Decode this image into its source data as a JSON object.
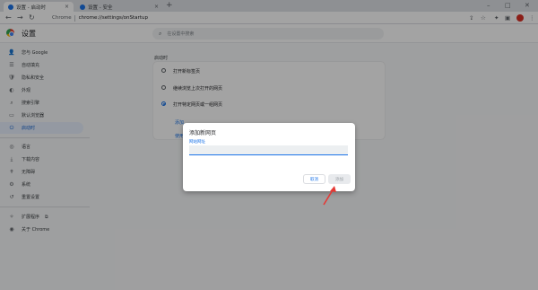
{
  "browser": {
    "tabs": [
      {
        "label": "设置 - 启动时",
        "active": true,
        "close": "×"
      },
      {
        "label": "设置 - 安全",
        "active": false,
        "close": "×"
      }
    ],
    "new_tab": "+",
    "window_controls": {
      "minimize": "–",
      "maximize": "□",
      "close": "✕"
    },
    "nav": {
      "back": "←",
      "forward": "→",
      "reload": "↻"
    },
    "address": {
      "site_label": "Chrome",
      "url": "chrome://settings/onStartup"
    },
    "toolbar_icons": [
      "share-icon",
      "star-icon",
      "extensions-icon",
      "sidebar-icon",
      "profile-avatar",
      "menu-icon"
    ],
    "toolbar_glyphs": {
      "share": "⇪",
      "star": "☆",
      "extensions": "✦",
      "sidebar": "▣",
      "menu": "⋮"
    }
  },
  "settings": {
    "title": "设置",
    "search_placeholder": "在设置中搜索",
    "search_glyph": "⌕",
    "sidebar": [
      {
        "label": "您与 Google",
        "icon": "person-icon",
        "glyph": "👤"
      },
      {
        "label": "自动填充",
        "icon": "autofill-icon",
        "glyph": "☰"
      },
      {
        "label": "隐私和安全",
        "icon": "shield-icon",
        "glyph": "🛡"
      },
      {
        "label": "外观",
        "icon": "palette-icon",
        "glyph": "◐"
      },
      {
        "label": "搜索引擎",
        "icon": "search-icon",
        "glyph": "⌕"
      },
      {
        "label": "默认浏览器",
        "icon": "browser-icon",
        "glyph": "▭"
      },
      {
        "label": "启动时",
        "icon": "power-icon",
        "glyph": "⏻",
        "active": true
      },
      {
        "label": "语言",
        "icon": "globe-icon",
        "glyph": "◎"
      },
      {
        "label": "下载内容",
        "icon": "download-icon",
        "glyph": "⤓"
      },
      {
        "label": "无障碍",
        "icon": "accessibility-icon",
        "glyph": "✝"
      },
      {
        "label": "系统",
        "icon": "wrench-icon",
        "glyph": "⚙"
      },
      {
        "label": "重置设置",
        "icon": "reset-icon",
        "glyph": "↺"
      },
      {
        "label": "扩展程序",
        "icon": "puzzle-icon",
        "glyph": "✧",
        "external": "⧉"
      },
      {
        "label": "关于 Chrome",
        "icon": "chrome-icon",
        "glyph": "◉"
      }
    ],
    "section_label": "启动时",
    "startup_options": [
      {
        "label": "打开新标签页",
        "selected": false
      },
      {
        "label": "继续浏览上次打开的网页",
        "selected": false
      },
      {
        "label": "打开特定网页或一组网页",
        "selected": true
      }
    ],
    "card_links": [
      "添加",
      "使用"
    ]
  },
  "dialog": {
    "title": "添加新网页",
    "field_label": "网站网址",
    "field_value": "",
    "cancel": "取消",
    "add": "添加"
  },
  "colors": {
    "accent": "#1a73e8",
    "overlay": "rgba(0,0,0,0.36)",
    "annotation_arrow": "#e53935"
  }
}
